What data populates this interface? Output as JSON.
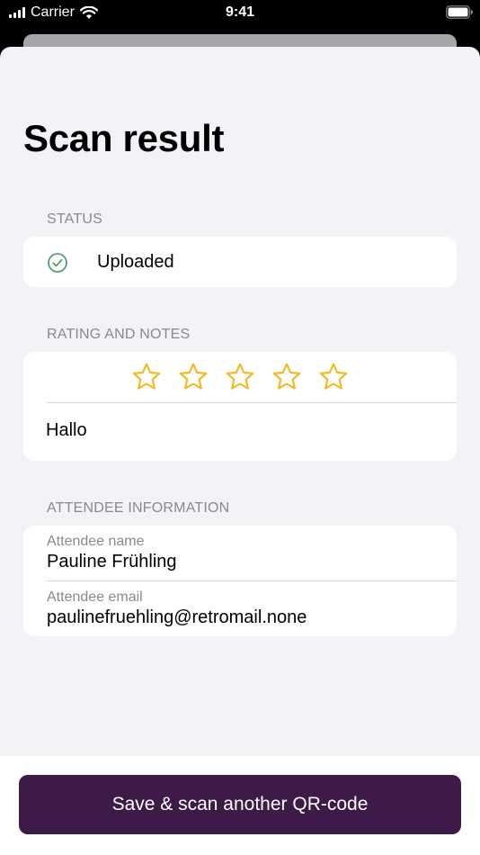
{
  "status_bar": {
    "carrier": "Carrier",
    "time": "9:41",
    "signal_icon": "cellular-signal-icon",
    "wifi_icon": "wifi-icon",
    "battery_icon": "battery-icon"
  },
  "page": {
    "title": "Scan result"
  },
  "status_section": {
    "header": "STATUS",
    "icon": "check-circle-icon",
    "value": "Uploaded"
  },
  "rating_section": {
    "header": "RATING AND NOTES",
    "rating": 0,
    "max_rating": 5,
    "star_icon": "star-outline-icon",
    "notes": "Hallo"
  },
  "attendee_section": {
    "header": "ATTENDEE INFORMATION",
    "name_label": "Attendee name",
    "name_value": "Pauline Frühling",
    "email_label": "Attendee email",
    "email_value": "paulinefruehling@retromail.none"
  },
  "actions": {
    "save_label": "Save & scan another QR-code"
  },
  "colors": {
    "accent": "#3e1a48",
    "star": "#f5b81c",
    "success": "#3a9a5b",
    "background": "#f2f2f7"
  }
}
